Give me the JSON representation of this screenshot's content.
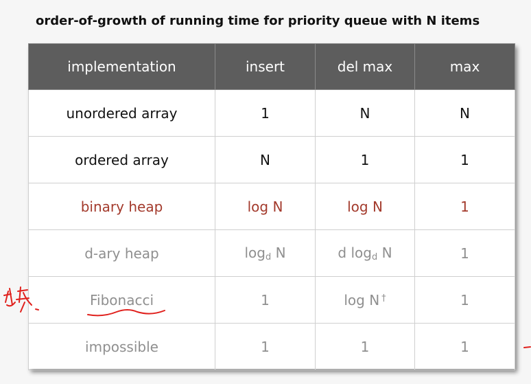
{
  "title": "order-of-growth of running time for priority queue with N items",
  "table": {
    "headers": [
      "implementation",
      "insert",
      "del max",
      "max"
    ],
    "rows": [
      {
        "style": "normal",
        "impl": "unordered array",
        "insert": "1",
        "delmax": "N",
        "max": "N"
      },
      {
        "style": "normal",
        "impl": "ordered array",
        "insert": "N",
        "delmax": "1",
        "max": "1"
      },
      {
        "style": "red",
        "impl": "binary heap",
        "insert": "log N",
        "delmax": "log N",
        "max": "1"
      },
      {
        "style": "gray",
        "impl": "d-ary heap",
        "insert_base": "log",
        "insert_sub": "d",
        "insert_tail": " N",
        "delmax_base": "d log",
        "delmax_sub": "d",
        "delmax_tail": " N",
        "max": "1"
      },
      {
        "style": "gray",
        "impl": "Fibonacci",
        "insert": "1",
        "delmax": "log N",
        "delmax_mark": "†",
        "max": "1"
      },
      {
        "style": "gray",
        "impl": "impossible",
        "insert": "1",
        "delmax": "1",
        "max": "1"
      }
    ]
  },
  "colors": {
    "header_bg": "#5d5d5d",
    "highlight_red": "#a33a2c",
    "muted_gray": "#8f8f8f",
    "annotation_red": "#e0201c"
  },
  "annotation_icon": "handwritten-scribble-icon"
}
